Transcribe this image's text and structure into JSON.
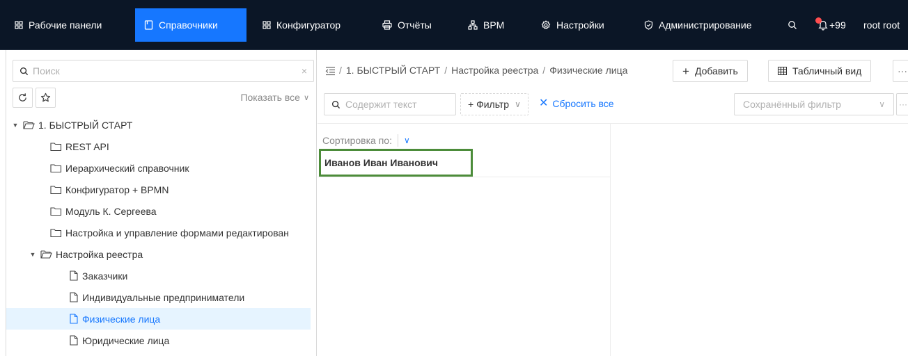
{
  "nav": {
    "items": [
      {
        "label": "Рабочие панели",
        "icon": "grid-icon"
      },
      {
        "label": "Справочники",
        "icon": "book-icon",
        "active": true
      },
      {
        "label": "Конфигуратор",
        "icon": "grid-icon"
      },
      {
        "label": "Отчёты",
        "icon": "printer-icon"
      },
      {
        "label": "BPM",
        "icon": "sitemap-icon"
      },
      {
        "label": "Настройки",
        "icon": "gear-icon"
      },
      {
        "label": "Администрирование",
        "icon": "shield-check-icon"
      }
    ],
    "search_icon": "search-icon",
    "notifications": {
      "icon": "bell-icon",
      "count": "+99"
    },
    "user": "root root"
  },
  "sidebar": {
    "search_placeholder": "Поиск",
    "clear_symbol": "×",
    "refresh_icon": "refresh-icon",
    "favorite_icon": "star-icon",
    "show_all": "Показать все",
    "tree": [
      {
        "label": "1. БЫСТРЫЙ СТАРТ",
        "level": 0,
        "expanded": true,
        "kind": "folder-open"
      },
      {
        "label": "REST API",
        "level": 1,
        "kind": "folder"
      },
      {
        "label": "Иерархический справочник",
        "level": 1,
        "kind": "folder"
      },
      {
        "label": "Конфигуратор + BPMN",
        "level": 1,
        "kind": "folder"
      },
      {
        "label": "Модуль К. Сергеева",
        "level": 1,
        "kind": "folder"
      },
      {
        "label": "Настройка и управление формами редактирован",
        "level": 1,
        "kind": "folder"
      },
      {
        "label": "Настройка реестра",
        "level": 1,
        "expanded": true,
        "kind": "folder-open"
      },
      {
        "label": "Заказчики",
        "level": 2,
        "kind": "file"
      },
      {
        "label": "Индивидуальные предприниматели",
        "level": 2,
        "kind": "file"
      },
      {
        "label": "Физические лица",
        "level": 2,
        "kind": "file",
        "selected": true
      },
      {
        "label": "Юридические лица",
        "level": 2,
        "kind": "file"
      }
    ]
  },
  "breadcrumb": {
    "toggle_icon": "menu-fold-icon",
    "separator": "/",
    "items": [
      "1. БЫСТРЫЙ СТАРТ",
      "Настройка реестра",
      "Физические лица"
    ]
  },
  "toolbar": {
    "add_label": "Добавить",
    "table_view_label": "Табличный вид",
    "more_symbol": "···"
  },
  "filters": {
    "search_placeholder": "Содержит текст",
    "filter_label": "+ Фильтр",
    "reset_label": "Сбросить все",
    "saved_filter_placeholder": "Сохранённый фильтр",
    "saved_more_symbol": "···"
  },
  "list": {
    "sort_label": "Сортировка по:",
    "records": [
      "Иванов Иван Иванович"
    ]
  },
  "colors": {
    "nav_bg": "#0b1626",
    "accent": "#1677ff",
    "selected_bg": "#e6f4ff",
    "highlight_border": "#4c8c3a"
  }
}
